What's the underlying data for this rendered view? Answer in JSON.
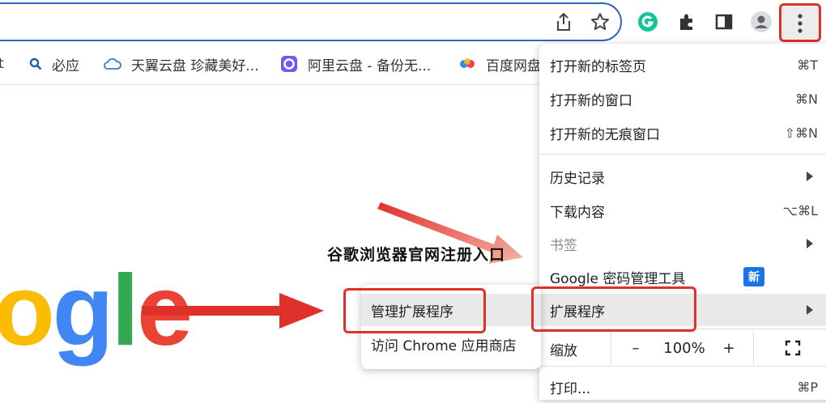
{
  "toolbar": {
    "icons": [
      "share-icon",
      "star-icon",
      "grammarly-icon",
      "extensions-icon",
      "sidepanel-icon",
      "profile-icon",
      "menu-icon"
    ]
  },
  "bookmarks": [
    {
      "label": "t",
      "icon": "none"
    },
    {
      "label": "必应",
      "icon": "search-icon"
    },
    {
      "label": "天翼云盘 珍藏美好...",
      "icon": "cloud-icon"
    },
    {
      "label": "阿里云盘 - 备份无...",
      "icon": "aliyun-icon"
    },
    {
      "label": "百度网盘",
      "icon": "baidu-cloud-icon"
    }
  ],
  "google_logo": {
    "letters": [
      {
        "ch": "o",
        "color": "#fbbc05"
      },
      {
        "ch": "g",
        "color": "#4285f4"
      },
      {
        "ch": "l",
        "color": "#34a853"
      },
      {
        "ch": "e",
        "color": "#ea4335"
      }
    ]
  },
  "watermark": "谷歌浏览器官网注册入口",
  "menu": {
    "items": [
      {
        "label": "打开新的标签页",
        "shortcut": "⌘T"
      },
      {
        "label": "打开新的窗口",
        "shortcut": "⌘N"
      },
      {
        "label": "打开新的无痕窗口",
        "shortcut": "⇧⌘N"
      },
      {
        "label": "历史记录"
      },
      {
        "label": "下载内容",
        "shortcut": "⌥⌘L"
      },
      {
        "label": "书签"
      },
      {
        "label": "Google 密码管理工具",
        "badge": "新"
      },
      {
        "label": "扩展程序"
      },
      {
        "label": "打印...",
        "shortcut": "⌘P"
      }
    ],
    "zoom": {
      "label": "缩放",
      "minus": "–",
      "value": "100%",
      "plus": "+"
    }
  },
  "submenu": {
    "items": [
      {
        "label": "管理扩展程序"
      },
      {
        "label": "访问 Chrome 应用商店"
      }
    ]
  },
  "colors": {
    "annotation_red": "#e0302a",
    "badge_blue": "#1a73e8"
  }
}
